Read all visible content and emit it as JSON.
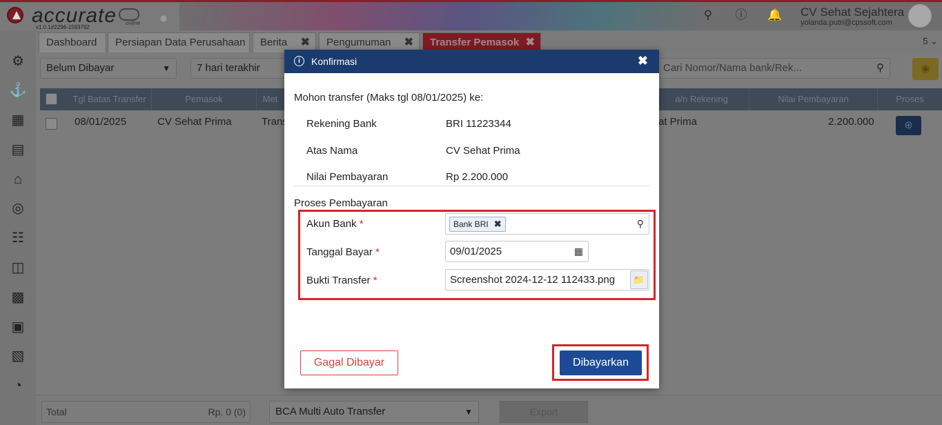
{
  "app": {
    "logo_text": "accurate",
    "logo_sub": "v1.0.1#2296-1593762",
    "logo_online": "online",
    "company_name": "CV Sehat Sejahtera",
    "company_email": "yolanda.putri@cpssoft.com"
  },
  "tabs": [
    {
      "label": "Dashboard",
      "closable": false
    },
    {
      "label": "Persiapan Data Perusahaan",
      "closable": false
    },
    {
      "label": "Berita",
      "closable": true
    },
    {
      "label": "Pengumuman",
      "closable": true
    },
    {
      "label": "Transfer Pemasok",
      "closable": true,
      "active": true
    }
  ],
  "tabs_more": "5",
  "filters": {
    "status": "Belum Dibayar",
    "period": "7 hari terakhir",
    "search_placeholder": "Cari Nomor/Nama bank/Rek..."
  },
  "table": {
    "headers": [
      "Tgl Batas Transfer",
      "Pemasok",
      "Met",
      "a/n Rekening",
      "Nilai Pembayaran",
      "Proses"
    ],
    "rows": [
      {
        "tgl": "08/01/2025",
        "pemasok": "CV Sehat Prima",
        "metode": "Trans",
        "an_rekening": "at Prima",
        "nilai": "2.200.000"
      }
    ]
  },
  "footer": {
    "total_label": "Total",
    "total_value": "Rp. 0 (0)",
    "bank_select": "BCA Multi Auto Transfer",
    "export_label": "Export"
  },
  "modal": {
    "title": "Konfirmasi",
    "intro": "Mohon transfer (Maks tgl 08/01/2025) ke:",
    "rekening_label": "Rekening Bank",
    "rekening_value": "BRI 11223344",
    "atas_nama_label": "Atas Nama",
    "atas_nama_value": "CV Sehat Prima",
    "nilai_label": "Nilai Pembayaran",
    "nilai_value": "Rp 2.200.000",
    "section": "Proses Pembayaran",
    "akun_label": "Akun Bank",
    "akun_value": "Bank BRI",
    "tanggal_label": "Tanggal Bayar",
    "tanggal_value": "09/01/2025",
    "bukti_label": "Bukti Transfer",
    "bukti_value": "Screenshot 2024-12-12 112433.png",
    "required_mark": "*",
    "btn_gagal": "Gagal Dibayar",
    "btn_bayar": "Dibayarkan"
  },
  "colors": {
    "modal_header": "#1b3b6f",
    "primary_button": "#1c4a96",
    "danger": "#d9413d",
    "highlight_box": "#d8232a"
  }
}
